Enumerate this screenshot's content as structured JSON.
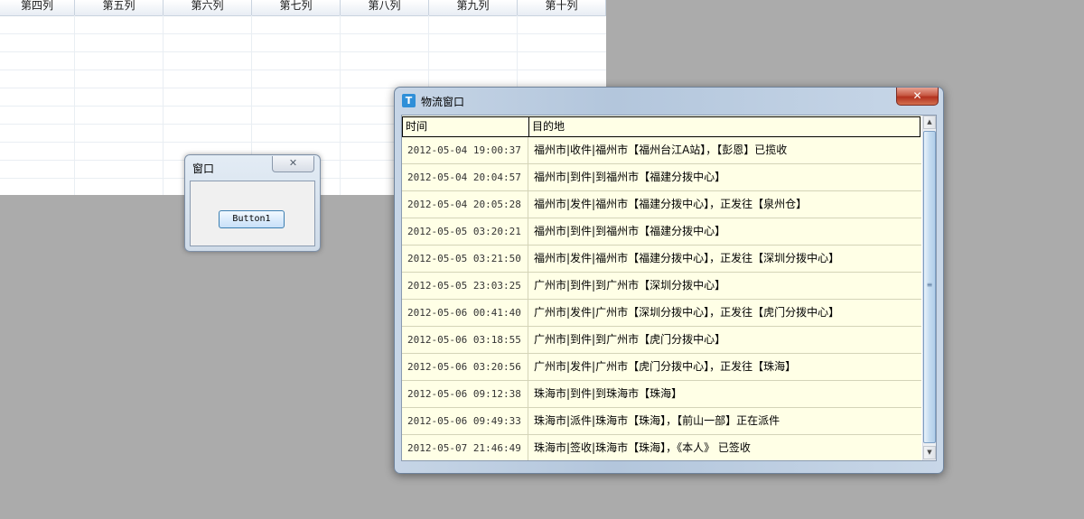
{
  "spreadsheet": {
    "columns": [
      "第四列",
      "第五列",
      "第六列",
      "第七列",
      "第八列",
      "第九列",
      "第十列"
    ]
  },
  "small_window": {
    "title": "窗口",
    "close_glyph": "✕",
    "button_label": "Button1"
  },
  "logistics_window": {
    "title": "物流窗口",
    "icon_glyph": "T",
    "close_glyph": "✕",
    "headers": {
      "time": "时间",
      "destination": "目的地"
    },
    "rows": [
      {
        "time": "2012-05-04 19:00:37",
        "destination": "福州市|收件|福州市【福州台江A站】，【彭恩】已揽收"
      },
      {
        "time": "2012-05-04 20:04:57",
        "destination": "福州市|到件|到福州市【福建分拨中心】"
      },
      {
        "time": "2012-05-04 20:05:28",
        "destination": "福州市|发件|福州市【福建分拨中心】，正发往【泉州仓】"
      },
      {
        "time": "2012-05-05 03:20:21",
        "destination": "福州市|到件|到福州市【福建分拨中心】"
      },
      {
        "time": "2012-05-05 03:21:50",
        "destination": "福州市|发件|福州市【福建分拨中心】，正发往【深圳分拨中心】"
      },
      {
        "time": "2012-05-05 23:03:25",
        "destination": "广州市|到件|到广州市【深圳分拨中心】"
      },
      {
        "time": "2012-05-06 00:41:40",
        "destination": "广州市|发件|广州市【深圳分拨中心】，正发往【虎门分拨中心】"
      },
      {
        "time": "2012-05-06 03:18:55",
        "destination": "广州市|到件|到广州市【虎门分拨中心】"
      },
      {
        "time": "2012-05-06 03:20:56",
        "destination": "广州市|发件|广州市【虎门分拨中心】，正发往【珠海】"
      },
      {
        "time": "2012-05-06 09:12:38",
        "destination": "珠海市|到件|到珠海市【珠海】"
      },
      {
        "time": "2012-05-06 09:49:33",
        "destination": "珠海市|派件|珠海市【珠海】，【前山一部】正在派件"
      },
      {
        "time": "2012-05-07 21:46:49",
        "destination": "珠海市|签收|珠海市【珠海】，《本人》 已签收"
      }
    ],
    "scrollbar": {
      "up_glyph": "▲",
      "down_glyph": "▼",
      "grip_glyph": "≡"
    }
  }
}
